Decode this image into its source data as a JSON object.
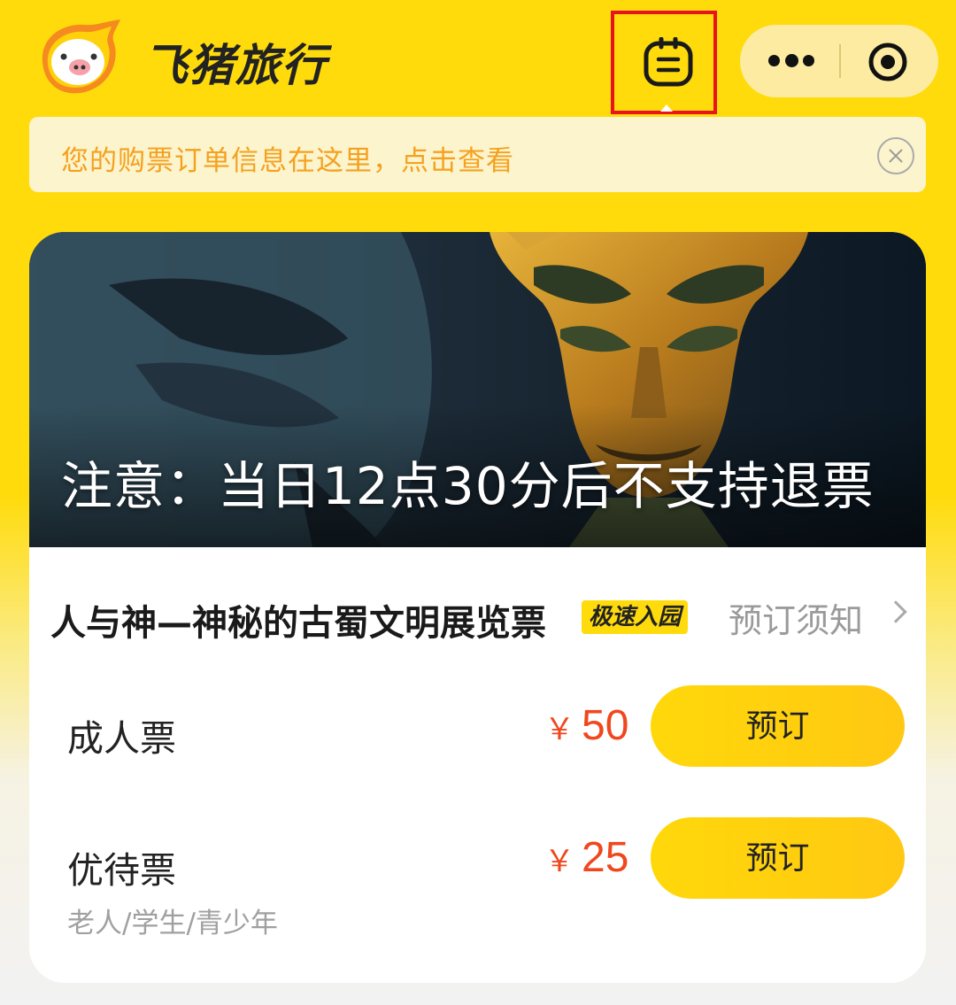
{
  "header": {
    "brand": "飞猪旅行",
    "orders_icon": "order-list-icon",
    "menu_icons": [
      "more-dots-icon",
      "target-icon"
    ]
  },
  "notice": {
    "text": "您的购票订单信息在这里，点击查看",
    "close_icon": "close-circle-icon"
  },
  "banner": {
    "caption": "注意：当日12点30分后不支持退票"
  },
  "product": {
    "title": "人与神—神秘的古蜀文明展览票",
    "badge": "极速入园",
    "booking_notice": "预订须知"
  },
  "tickets": [
    {
      "name": "成人票",
      "currency": "￥",
      "price": "50",
      "button": "预订",
      "subtitle": ""
    },
    {
      "name": "优待票",
      "currency": "￥",
      "price": "25",
      "button": "预订",
      "subtitle": "老人/学生/青少年"
    }
  ],
  "colors": {
    "brand_yellow": "#FFDB0C",
    "price_orange": "#F0471D",
    "notice_orange": "#F5A11E",
    "highlight_red": "#E8141D"
  }
}
